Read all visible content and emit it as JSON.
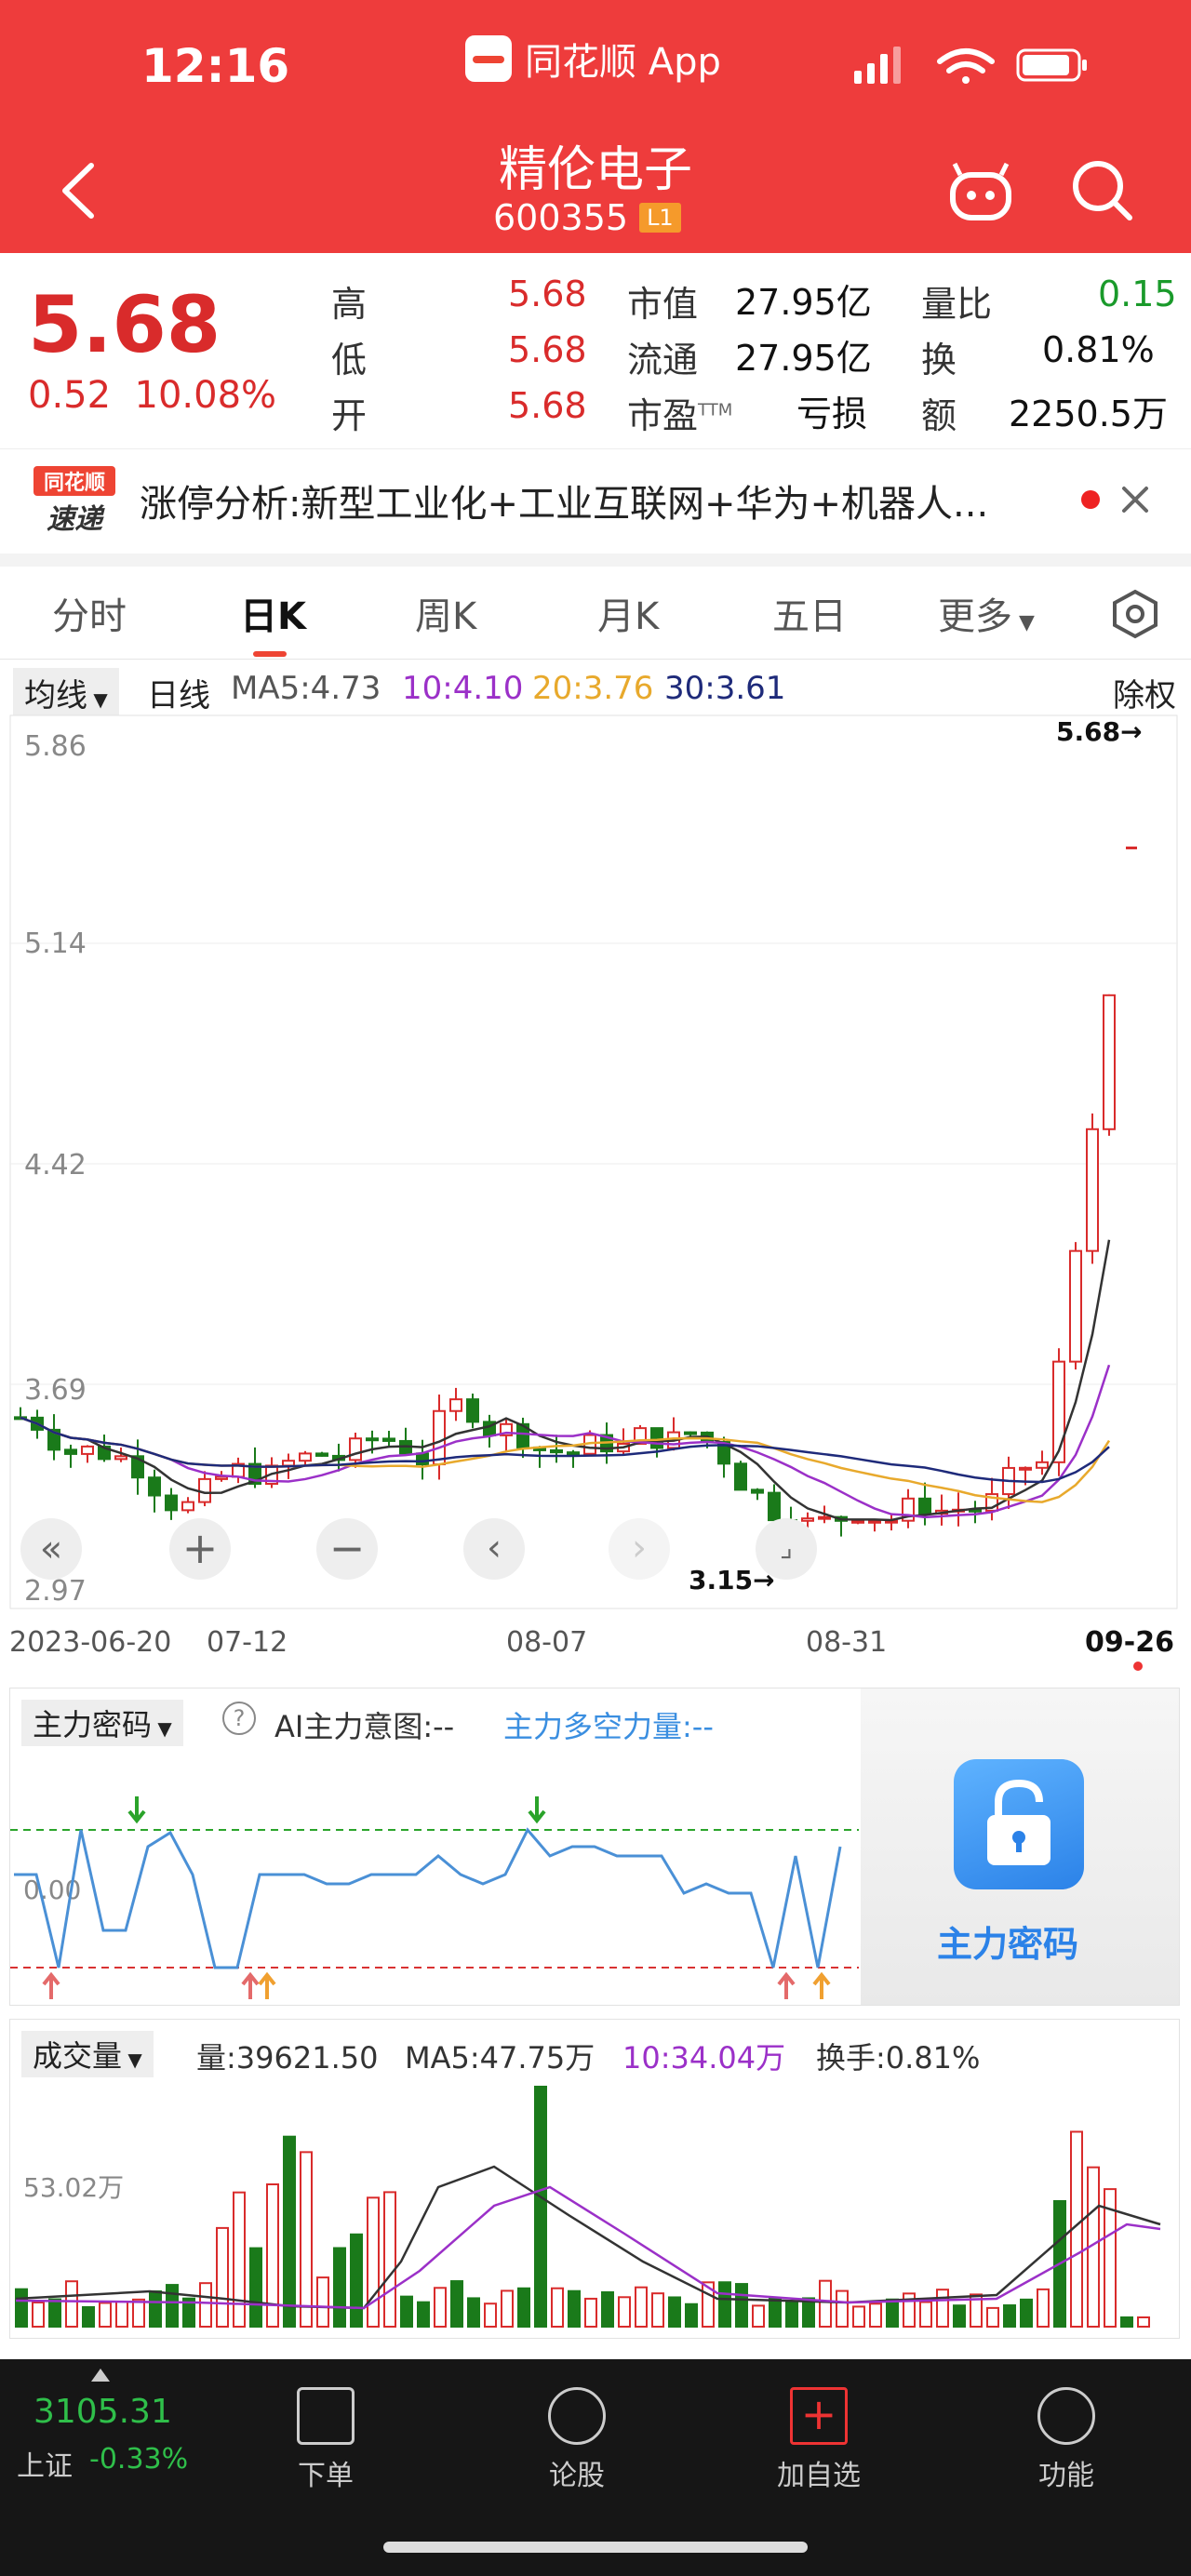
{
  "status": {
    "time": "12:16",
    "app_name": "同花顺 App"
  },
  "header": {
    "stock_name": "精伦电子",
    "stock_code": "600355",
    "level_badge": "L1"
  },
  "quote": {
    "price": "5.68",
    "change": "0.52",
    "change_pct": "10.08%",
    "high_label": "高",
    "high": "5.68",
    "low_label": "低",
    "low": "5.68",
    "open_label": "开",
    "open": "5.68",
    "mktcap_label": "市值",
    "mktcap": "27.95亿",
    "float_label": "流通",
    "float": "27.95亿",
    "pe_label": "市盈",
    "pe_sup": "TTM",
    "pe": "亏损",
    "vol_ratio_label": "量比",
    "vol_ratio": "0.15",
    "turnover_label": "换",
    "turnover": "0.81%",
    "amount_label": "额",
    "amount": "2250.5万"
  },
  "news": {
    "badge_line1": "同花顺",
    "badge_line2": "速递",
    "text": "涨停分析:新型工业化+工业互联网+华为+机器人..."
  },
  "tabs": [
    "分时",
    "日K",
    "周K",
    "月K",
    "五日",
    "更多"
  ],
  "active_tab": "日K",
  "kline": {
    "indicator_select": "均线",
    "period": "日线",
    "ma5": "MA5:4.73",
    "ma10": "10:4.10",
    "ma20": "20:3.76",
    "ma30": "30:3.61",
    "adjust": "除权",
    "price_ticks": [
      "5.86",
      "5.14",
      "4.42",
      "3.69",
      "2.97"
    ],
    "max_marker": "5.68→",
    "min_marker": "3.15→",
    "dates": [
      "2023-06-20",
      "07-12",
      "08-07",
      "08-31",
      "09-26"
    ]
  },
  "main_force": {
    "select": "主力密码",
    "help": "?",
    "ai_text": "AI主力意图:--",
    "power_text": "主力多空力量:--",
    "zero_tick": "0.00",
    "lock_label": "主力密码"
  },
  "volume": {
    "select": "成交量",
    "vol": "量:39621.50",
    "ma5": "MA5:47.75万",
    "ma10": "10:34.04万",
    "turnover": "换手:0.81%",
    "tick": "53.02万"
  },
  "bottom_nav": {
    "index_value": "3105.31",
    "index_name": "上证",
    "index_change": "-0.33%",
    "items": [
      "下单",
      "论股",
      "加自选",
      "功能"
    ]
  },
  "colors": {
    "brand_red": "#ee3c3c",
    "up": "#d92b2b",
    "down": "#1a7a1a",
    "ma5": "#333333",
    "ma10": "#9b30c8",
    "ma20": "#e8a92c",
    "ma30": "#1e2a7a"
  }
}
